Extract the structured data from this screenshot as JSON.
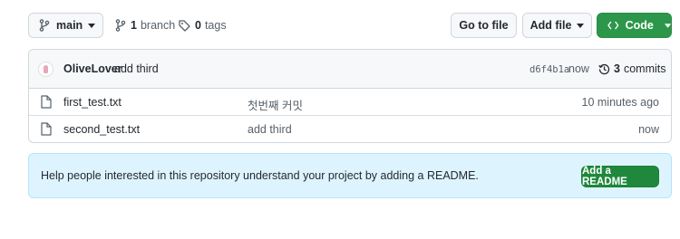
{
  "toolbar": {
    "branch_name": "main",
    "branch_count": "1",
    "branch_label": "branch",
    "tag_count": "0",
    "tag_label": "tags",
    "go_to_file": "Go to file",
    "add_file": "Add file",
    "code": "Code"
  },
  "commit": {
    "author": "OliveLover",
    "message": "add third",
    "sha": "d6f4b1a",
    "time": "now",
    "count": "3",
    "count_label": "commits"
  },
  "files": [
    {
      "name": "first_test.txt",
      "message": "첫번째 커밋",
      "time": "10 minutes ago"
    },
    {
      "name": "second_test.txt",
      "message": "add third",
      "time": "now"
    }
  ],
  "readme": {
    "text": "Help people interested in this repository understand your project by adding a README.",
    "button": "Add a README"
  },
  "colors": {
    "code_button": "#2c974b",
    "readme_button": "#1f883d",
    "banner_bg": "#ddf4ff"
  },
  "icons": [
    "git-branch-icon",
    "tag-icon",
    "history-icon",
    "file-icon",
    "caret-down-icon",
    "code-icon"
  ]
}
